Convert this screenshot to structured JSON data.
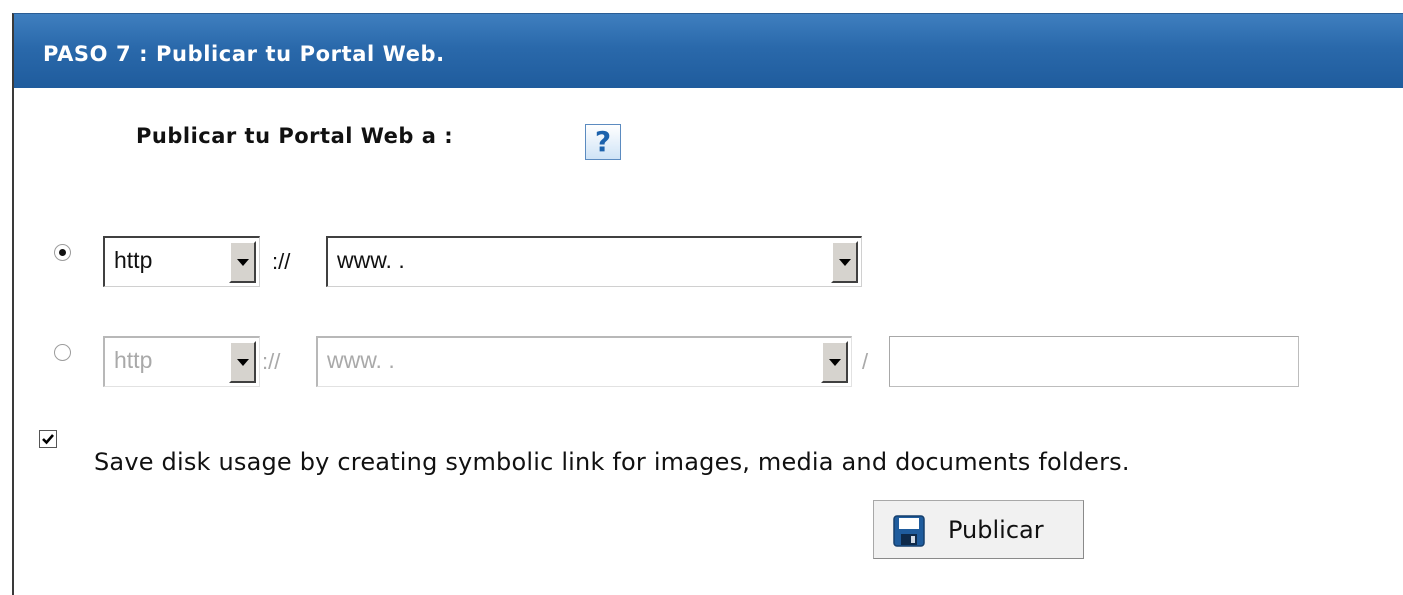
{
  "panel": {
    "title": "PASO 7 : Publicar tu Portal Web."
  },
  "publish_to": {
    "label": "Publicar tu Portal Web a :",
    "help_icon": "help-question-icon",
    "help_glyph": "?"
  },
  "option1": {
    "selected": true,
    "protocol": "http",
    "separator": "://",
    "domain": "www.  ."
  },
  "option2": {
    "selected": false,
    "disabled": true,
    "protocol": "http",
    "separator": "://",
    "domain": "www.  .",
    "path_separator": "/",
    "path_value": ""
  },
  "symlink": {
    "checked": true,
    "label": "Save disk usage by creating symbolic link for images, media and documents folders."
  },
  "publish_button": {
    "label": "Publicar",
    "icon": "floppy-disk-icon"
  },
  "colors": {
    "header": "#2a69ab",
    "header_text": "#ffffff"
  }
}
